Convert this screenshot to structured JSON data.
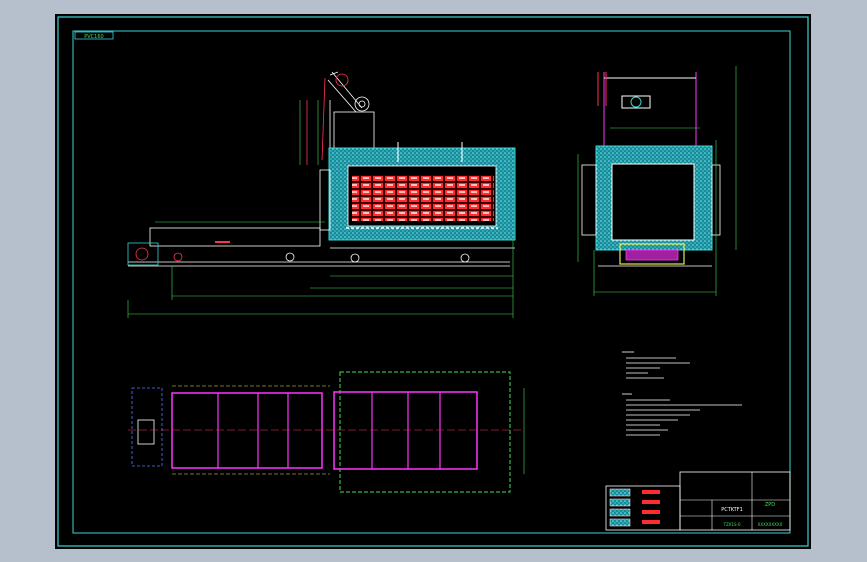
{
  "drawing": {
    "corner_tag": "PVC160",
    "title_block": {
      "drawing_name": "PCTKTF1",
      "drawing_code": "ZPD",
      "scale": "TZX1S-0",
      "designer": "XXXXXXXXX"
    }
  },
  "colors": {
    "window_bg": "#b6c0cc",
    "canvas": "#000000",
    "frame": "#39d4d4",
    "furnace_fill": "#22b6c4",
    "brick": "#ff2d2d",
    "rail": "#ff33ff",
    "dimension": "#3fe05a",
    "trolley": "#e8e854",
    "text": "#ffffff"
  }
}
